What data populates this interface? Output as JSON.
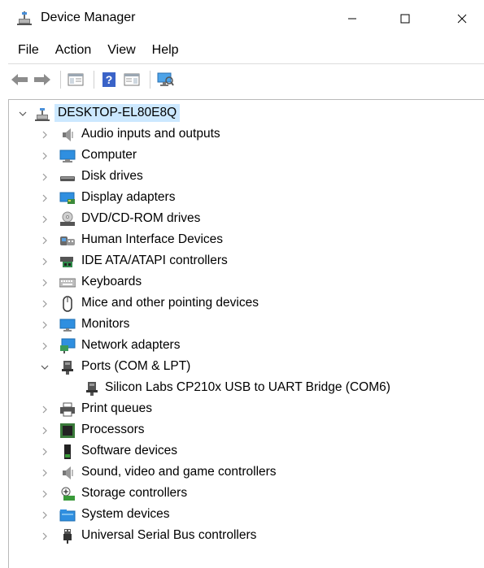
{
  "window": {
    "title": "Device Manager",
    "minimize_glyph": "—",
    "maximize_glyph": "☐",
    "close_glyph": "✕"
  },
  "menu": [
    "File",
    "Action",
    "View",
    "Help"
  ],
  "toolbar": [
    "back-arrow-icon",
    "forward-arrow-icon",
    "show-hide-console-tree-icon",
    "help-icon",
    "properties-icon",
    "scan-hardware-changes-icon"
  ],
  "tree": {
    "root": "DESKTOP-EL80E8Q",
    "categories": [
      {
        "label": "Audio inputs and outputs",
        "icon": "speaker-icon"
      },
      {
        "label": "Computer",
        "icon": "computer-icon"
      },
      {
        "label": "Disk drives",
        "icon": "disk-drive-icon"
      },
      {
        "label": "Display adapters",
        "icon": "display-adapter-icon"
      },
      {
        "label": "DVD/CD-ROM drives",
        "icon": "dvd-drive-icon"
      },
      {
        "label": "Human Interface Devices",
        "icon": "hid-icon"
      },
      {
        "label": "IDE ATA/ATAPI controllers",
        "icon": "ide-controller-icon"
      },
      {
        "label": "Keyboards",
        "icon": "keyboard-icon"
      },
      {
        "label": "Mice and other pointing devices",
        "icon": "mouse-icon"
      },
      {
        "label": "Monitors",
        "icon": "monitor-icon"
      },
      {
        "label": "Network adapters",
        "icon": "network-adapter-icon"
      },
      {
        "label": "Ports (COM & LPT)",
        "icon": "port-icon",
        "expanded": true,
        "children": [
          {
            "label": "Silicon Labs CP210x USB to UART Bridge (COM6)",
            "icon": "port-icon"
          }
        ]
      },
      {
        "label": "Print queues",
        "icon": "printer-icon"
      },
      {
        "label": "Processors",
        "icon": "processor-icon"
      },
      {
        "label": "Software devices",
        "icon": "software-device-icon"
      },
      {
        "label": "Sound, video and game controllers",
        "icon": "sound-controller-icon"
      },
      {
        "label": "Storage controllers",
        "icon": "storage-controller-icon"
      },
      {
        "label": "System devices",
        "icon": "system-devices-icon"
      },
      {
        "label": "Universal Serial Bus controllers",
        "icon": "usb-icon"
      }
    ]
  },
  "colors": {
    "selection": "#cce8ff",
    "border": "#b9b9b9",
    "expander": "#808080",
    "icon_blue": "#1e7ad8"
  }
}
